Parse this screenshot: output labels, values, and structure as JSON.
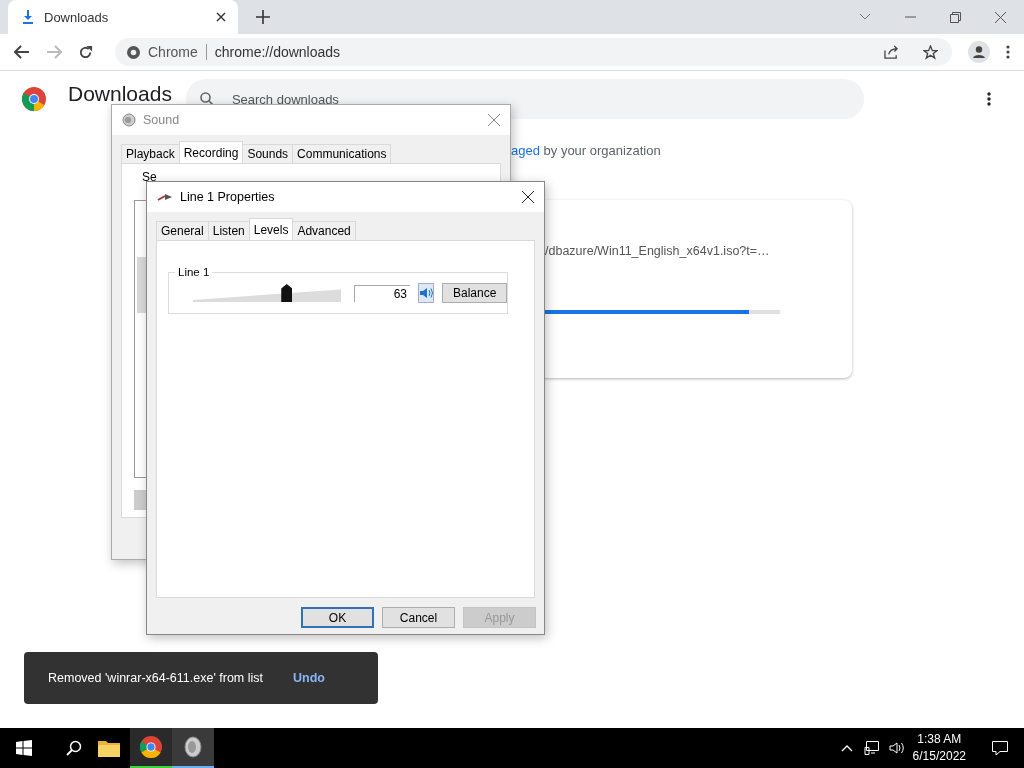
{
  "browser": {
    "tab": {
      "title": "Downloads"
    },
    "address": {
      "site": "Chrome",
      "url": "chrome://downloads"
    }
  },
  "page": {
    "title": "Downloads",
    "search": {
      "placeholder": "Search downloads"
    },
    "managed": {
      "link": "aged",
      "text": "by your organization"
    },
    "download": {
      "url": "/dbazure/Win11_English_x64v1.iso?t=…",
      "level": 0.87
    }
  },
  "toast": {
    "message": "Removed 'winrar-x64-611.exe' from list",
    "action": "Undo"
  },
  "sound_dialog": {
    "title": "Sound",
    "tabs": [
      {
        "label": "Playback",
        "selected": false
      },
      {
        "label": "Recording",
        "selected": true
      },
      {
        "label": "Sounds",
        "selected": false
      },
      {
        "label": "Communications",
        "selected": false
      }
    ],
    "hint": "Se"
  },
  "properties_dialog": {
    "title": "Line 1 Properties",
    "tabs": [
      {
        "label": "General",
        "selected": false
      },
      {
        "label": "Listen",
        "selected": false
      },
      {
        "label": "Levels",
        "selected": true
      },
      {
        "label": "Advanced",
        "selected": false
      }
    ],
    "group": {
      "label": "Line 1",
      "level": 0.63,
      "value": "63",
      "muted": false,
      "balance": "Balance"
    },
    "buttons": [
      {
        "label": "OK",
        "disabled": false,
        "default": true
      },
      {
        "label": "Cancel",
        "disabled": false,
        "default": false
      },
      {
        "label": "Apply",
        "disabled": true,
        "default": false
      }
    ]
  },
  "taskbar": {
    "time": "1:38 AM",
    "date": "6/15/2022"
  }
}
